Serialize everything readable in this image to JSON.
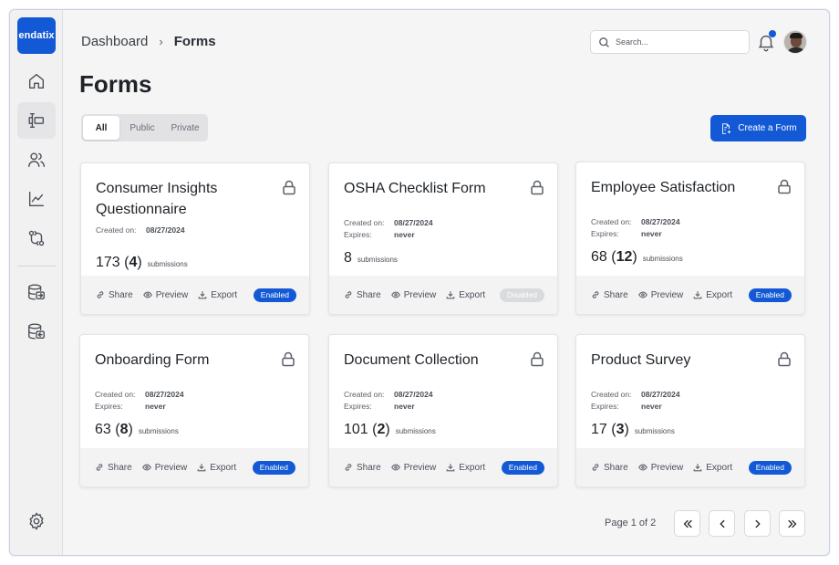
{
  "brand": {
    "logo_text": "endatix",
    "accent": "#1359d6"
  },
  "sidebar": {
    "items": [
      {
        "icon": "home-icon",
        "active": false
      },
      {
        "icon": "forms-icon",
        "active": true
      },
      {
        "icon": "users-icon",
        "active": false
      },
      {
        "icon": "chart-icon",
        "active": false
      },
      {
        "icon": "integrations-icon",
        "active": false
      },
      {
        "icon": "database-export-icon",
        "active": false
      },
      {
        "icon": "database-import-icon",
        "active": false
      }
    ],
    "settings_icon": "gear-icon"
  },
  "header": {
    "breadcrumb": {
      "root": "Dashboard",
      "separator": "›",
      "current": "Forms"
    },
    "search": {
      "placeholder": "Search...",
      "value": ""
    },
    "notifications_icon": "bell-icon"
  },
  "main": {
    "title": "Forms",
    "tabs": [
      {
        "label": "All",
        "selected": true
      },
      {
        "label": "Public",
        "selected": false
      },
      {
        "label": "Private",
        "selected": false
      }
    ],
    "create_button": "Create a Form"
  },
  "labels": {
    "created_on": "Created on:",
    "expires": "Expires:",
    "submissions": "submissions",
    "share": "Share",
    "preview": "Preview",
    "export": "Export"
  },
  "forms": [
    {
      "title": "Consumer Insights Questionnaire",
      "created_on": "08/27/2024",
      "expires": null,
      "total": "173",
      "new": "4",
      "status": "Enabled"
    },
    {
      "title": "OSHA Checklist Form",
      "created_on": "08/27/2024",
      "expires": "never",
      "total": "8",
      "new": null,
      "status": "Disabled"
    },
    {
      "title": "Employee Satisfaction",
      "created_on": "08/27/2024",
      "expires": "never",
      "total": "68",
      "new": "12",
      "status": "Enabled"
    },
    {
      "title": "Onboarding Form",
      "created_on": "08/27/2024",
      "expires": "never",
      "total": "63",
      "new": "8",
      "status": "Enabled"
    },
    {
      "title": "Document Collection",
      "created_on": "08/27/2024",
      "expires": "never",
      "total": "101",
      "new": "2",
      "status": "Enabled"
    },
    {
      "title": "Product Survey",
      "created_on": "08/27/2024",
      "expires": "never",
      "total": "17",
      "new": "3",
      "status": "Enabled"
    }
  ],
  "pagination": {
    "text": "Page 1 of 2",
    "current": 1,
    "total": 2
  }
}
